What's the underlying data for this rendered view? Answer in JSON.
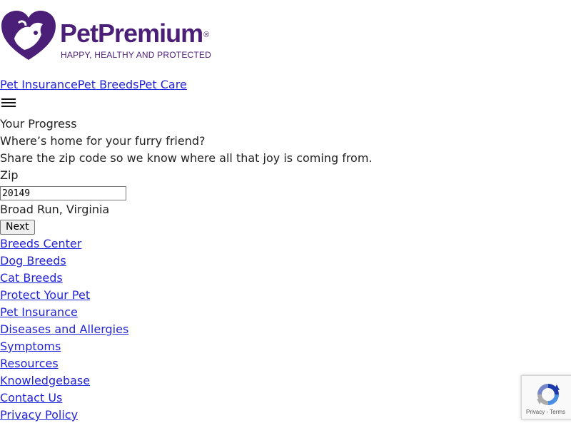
{
  "logo": {
    "brand": "PetPremium",
    "trademark": "®",
    "tagline": "HAPPY, HEALTHY AND PROTECTED",
    "brand_color": "#4b1e78"
  },
  "topnav": {
    "items": [
      "Pet Insurance",
      "Pet Breeds",
      "Pet Care"
    ]
  },
  "menu": {
    "icon": "hamburger-menu-icon"
  },
  "progress": {
    "label": "Your Progress"
  },
  "form": {
    "heading": "Where’s home for your furry friend?",
    "subheading": "Share the zip code so we know where all that joy is coming from.",
    "zip_label": "Zip",
    "zip_value": "20149",
    "location": "Broad Run, Virginia",
    "next_label": "Next"
  },
  "footer": {
    "links": [
      "Breeds Center",
      "Dog Breeds",
      "Cat Breeds",
      "Protect Your Pet",
      "Pet Insurance",
      "Diseases and Allergies",
      "Symptoms",
      "Resources",
      "Knowledgebase",
      "Contact Us",
      "Privacy Policy"
    ]
  },
  "recaptcha": {
    "privacy": "Privacy",
    "separator": " - ",
    "terms": "Terms"
  },
  "colors": {
    "link": "#2323d9",
    "text": "#222222"
  }
}
